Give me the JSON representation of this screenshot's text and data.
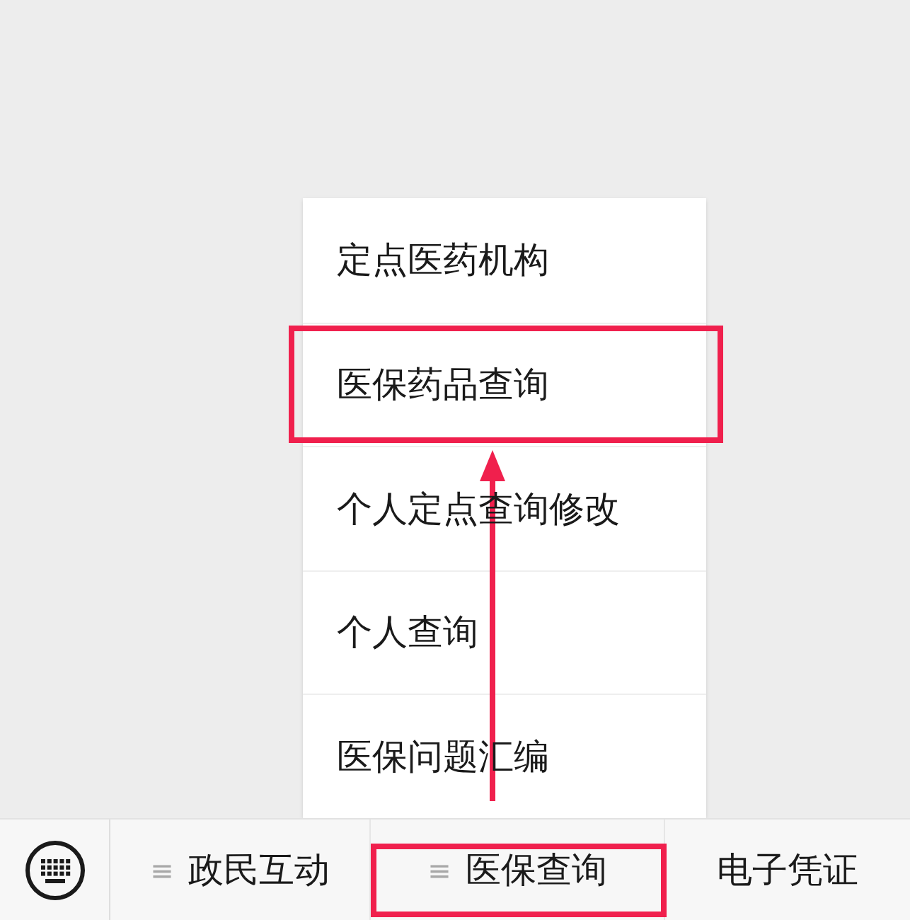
{
  "menu": {
    "items": [
      {
        "label": "定点医药机构",
        "highlighted": false
      },
      {
        "label": "医保药品查询",
        "highlighted": true
      },
      {
        "label": "个人定点查询修改",
        "highlighted": false
      },
      {
        "label": "个人查询",
        "highlighted": false
      },
      {
        "label": "医保问题汇编",
        "highlighted": false
      }
    ]
  },
  "bottom_bar": {
    "tabs": [
      {
        "label": "政民互动",
        "kind": "submenu",
        "menu_glyph": "≡",
        "highlighted": false
      },
      {
        "label": "医保查询",
        "kind": "submenu",
        "menu_glyph": "≡",
        "highlighted": true
      },
      {
        "label": "电子凭证",
        "kind": "link",
        "highlighted": false
      }
    ]
  }
}
